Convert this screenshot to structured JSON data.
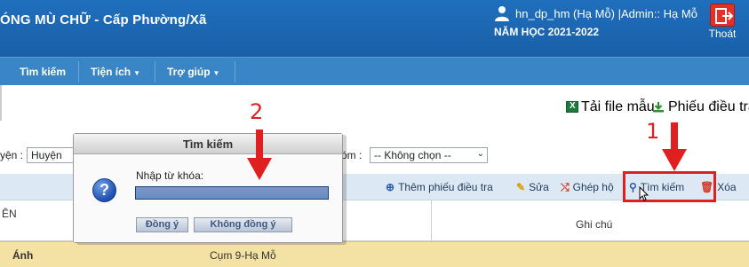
{
  "header": {
    "title": "ÓNG MÙ CHỮ - Cấp Phường/Xã",
    "user_info": "hn_dp_hm (Hạ Mỗ) |Admin:: Hạ Mỗ",
    "school_year": "NĂM HỌC 2021-2022",
    "logout_label": "Thoát"
  },
  "nav": {
    "items": [
      {
        "label": "Tìm kiếm",
        "has_dropdown": false
      },
      {
        "label": "Tiện ích",
        "has_dropdown": true
      },
      {
        "label": "Trợ giúp",
        "has_dropdown": true
      }
    ],
    "dropdown_glyph": "▼"
  },
  "toplinks": {
    "template_label": "Tải file mẫu",
    "survey_form_label": "Phiếu điều tra"
  },
  "filters": {
    "district_label": "yện :",
    "district_value": "Huyện",
    "second_label": "óm :",
    "second_value": "-- Không chọn --"
  },
  "toolbar": {
    "add_label": "Thêm phiếu điều tra",
    "edit_label": "Sửa",
    "merge_label": "Ghép hộ",
    "search_label": "Tìm kiếm",
    "delete_label": "Xóa"
  },
  "grid": {
    "headers": [
      "ÊN",
      "Ghi chú"
    ],
    "rows": [
      {
        "name": "Ánh",
        "group": "Cụm 9-Hạ Mỗ"
      }
    ]
  },
  "dialog": {
    "title": "Tìm kiếm",
    "prompt": "Nhập từ khóa:",
    "input_value": "",
    "ok_label": "Đồng ý",
    "cancel_label": "Không đồng ý"
  },
  "annotations": {
    "step1": "1",
    "step2": "2"
  },
  "colors": {
    "header_bg": "#1f6fbd",
    "nav_bg": "#3a85c6",
    "toolbar_bg": "#dce9f5",
    "row_highlight": "#f3e2a3",
    "annotation_red": "#e02020",
    "logout_red": "#e53027"
  }
}
